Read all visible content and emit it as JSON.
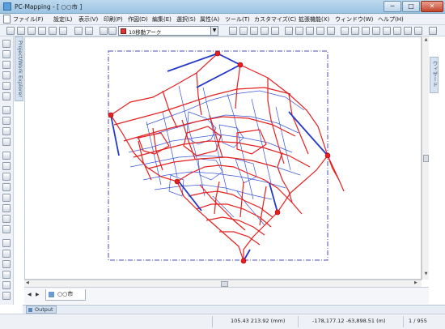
{
  "window": {
    "title": "PC-Mapping - [ ○○市 ]",
    "min": "─",
    "max": "□",
    "close": "✕"
  },
  "menu": [
    {
      "label": "ファイル(F)"
    },
    {
      "label": "設定(L)"
    },
    {
      "label": "表示(V)"
    },
    {
      "label": "印刷(P)"
    },
    {
      "label": "作図(D)"
    },
    {
      "label": "編集(E)"
    },
    {
      "label": "選択(S)"
    },
    {
      "label": "属性(A)"
    },
    {
      "label": "ツール(T)"
    },
    {
      "label": "カスタマイズ(C)"
    },
    {
      "label": "拡張機能(X)"
    },
    {
      "label": "ウィンドウ(W)"
    },
    {
      "label": "ヘルプ(H)"
    }
  ],
  "toolbar": {
    "layer_name": "10移動アーク",
    "layer_color": "#e53030",
    "arrow": "▼"
  },
  "side_panels": {
    "left": "Project/Work Explorer",
    "right": "ウィザード"
  },
  "map": {
    "arc_color": "#e52020",
    "link_color": "#3b55d8",
    "bound_color": "#4b4bb4",
    "node_color": "#e52020"
  },
  "tabs": {
    "active": "○○市",
    "prev": "◀",
    "next": "▶"
  },
  "scroll": {
    "up": "▲",
    "down": "▼",
    "left": "◀",
    "right": "▶"
  },
  "output": {
    "label": "Output"
  },
  "status": {
    "paper_coord": "105.43  213.92 (mm)",
    "map_coord": "-178,177.12  -63,898.51 (m)",
    "page": "1 / 955"
  }
}
